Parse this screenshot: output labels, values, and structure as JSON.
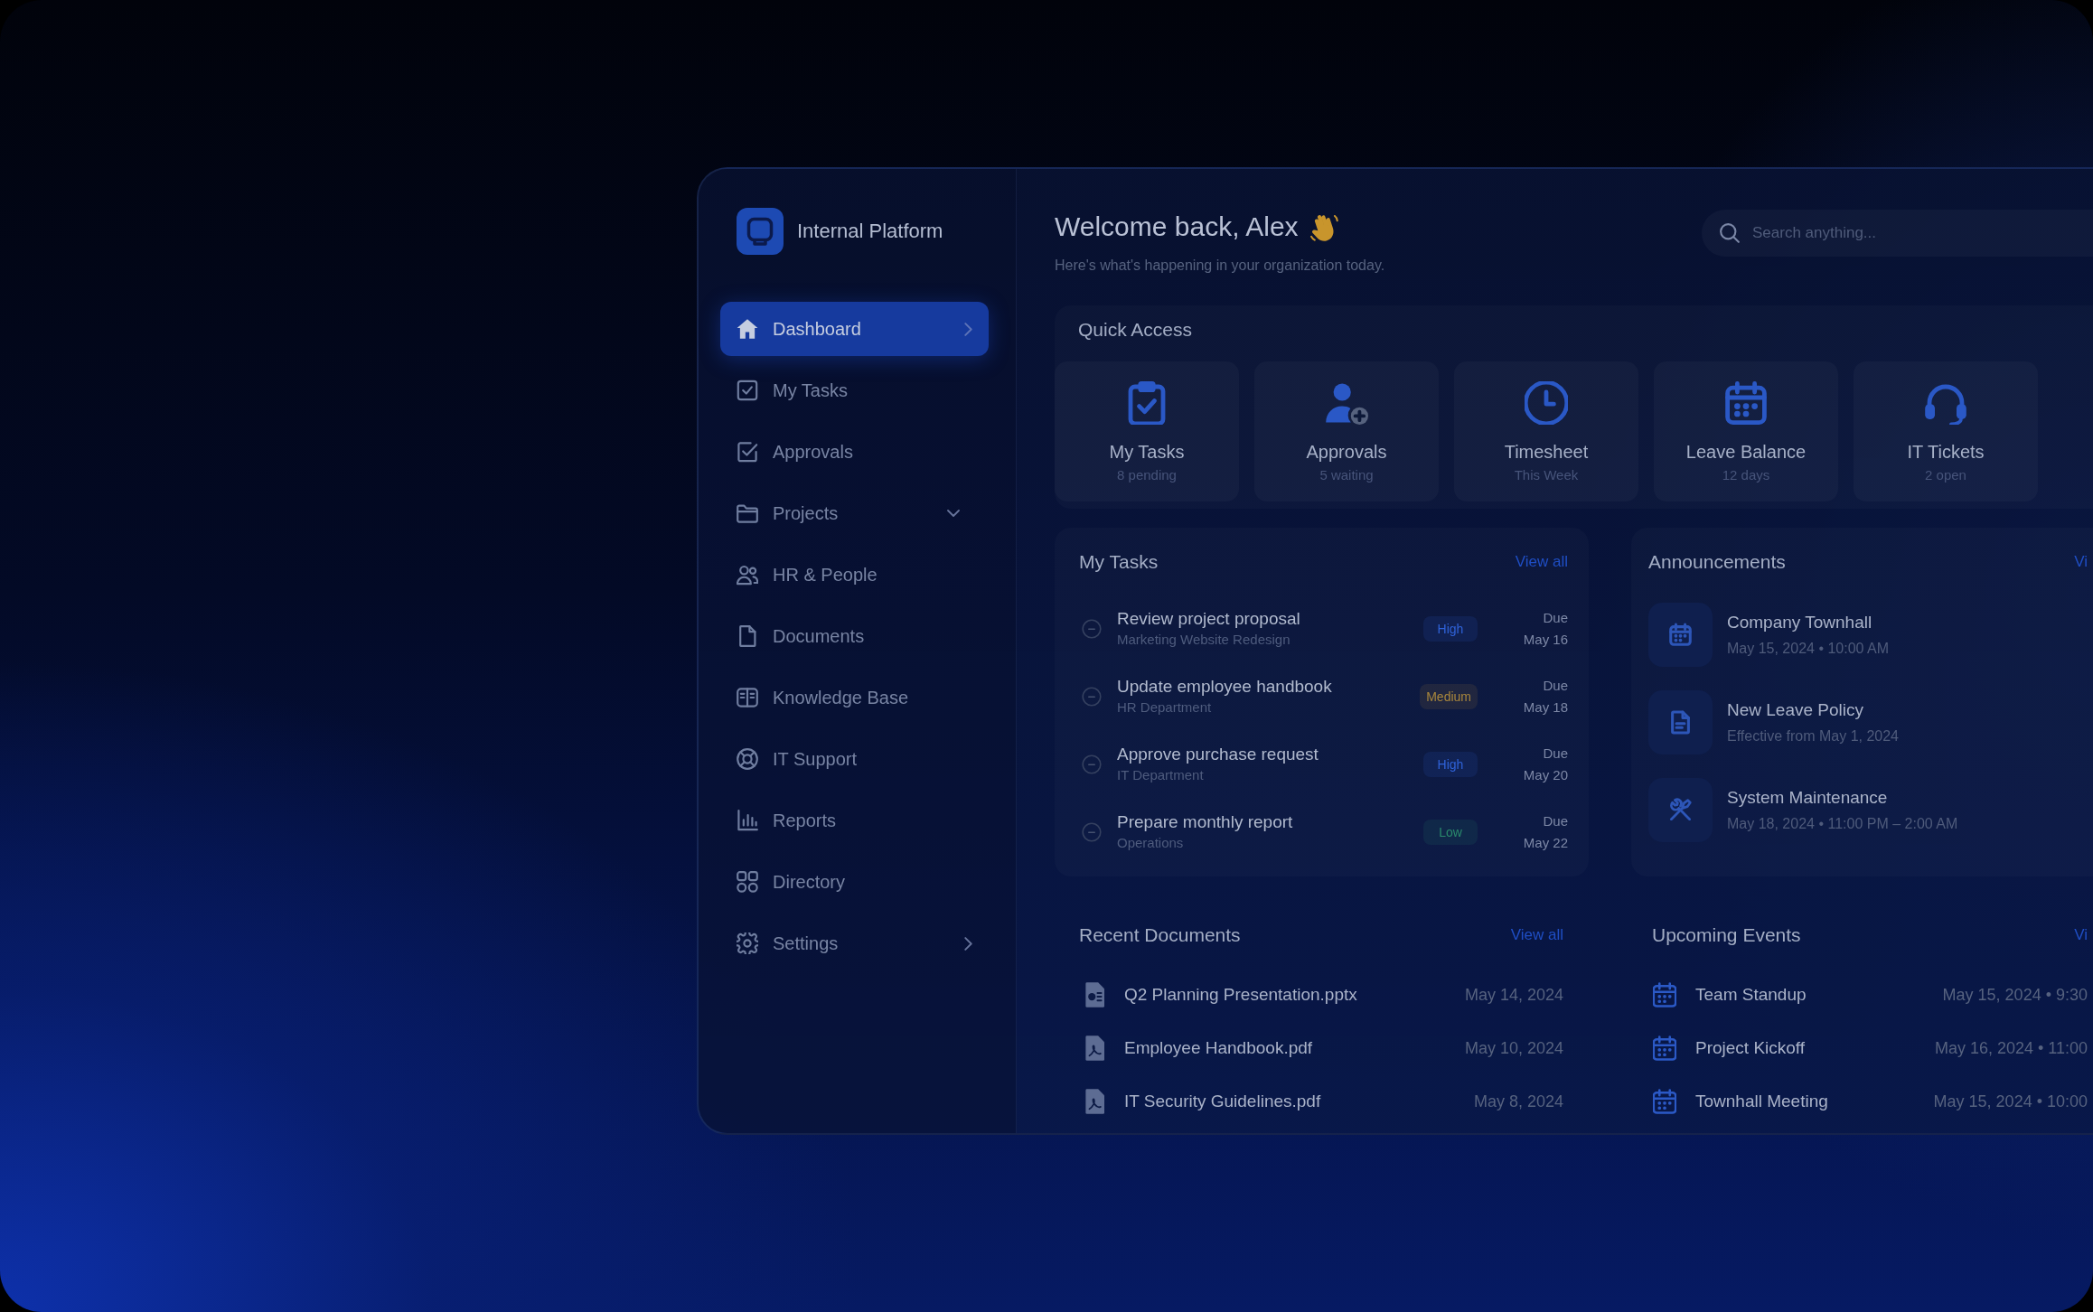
{
  "sidebar": {
    "brand": "Internal Platform",
    "items": [
      {
        "label": "Dashboard",
        "selected": true,
        "kind": "submenu"
      },
      {
        "label": "My Tasks",
        "selected": false,
        "kind": "plain"
      },
      {
        "label": "Approvals",
        "selected": false,
        "kind": "plain"
      },
      {
        "label": "Projects",
        "selected": false,
        "kind": "dropdown"
      },
      {
        "label": "HR & People",
        "selected": false,
        "kind": "plain"
      },
      {
        "label": "Documents",
        "selected": false,
        "kind": "plain"
      },
      {
        "label": "Knowledge Base",
        "selected": false,
        "kind": "plain"
      },
      {
        "label": "IT Support",
        "selected": false,
        "kind": "plain"
      },
      {
        "label": "Reports",
        "selected": false,
        "kind": "plain"
      },
      {
        "label": "Directory",
        "selected": false,
        "kind": "plain"
      },
      {
        "label": "Settings",
        "selected": false,
        "kind": "submenu"
      }
    ]
  },
  "header": {
    "title": "Welcome back, Alex",
    "subtitle": "Here's what's happening in your organization today.",
    "search": {
      "placeholder": "Search anything..."
    }
  },
  "quick_access": {
    "title": "Quick Access",
    "tiles": [
      {
        "label": "My Tasks",
        "detail": "8 pending"
      },
      {
        "label": "Approvals",
        "detail": "5 waiting"
      },
      {
        "label": "Timesheet",
        "detail": "This Week"
      },
      {
        "label": "Leave Balance",
        "detail": "12 days"
      },
      {
        "label": "IT Tickets",
        "detail": "2 open"
      }
    ]
  },
  "my_tasks": {
    "title": "My Tasks",
    "link": "View all",
    "items": [
      {
        "checked": false,
        "title": "Review project proposal",
        "project": "Marketing Website Redesign",
        "priority": "High",
        "color": "#2f62d8",
        "due_label": "Due",
        "due_date": "May 16"
      },
      {
        "checked": false,
        "title": "Update employee handbook",
        "project": "HR Department",
        "priority": "Medium",
        "color": "#a8863c",
        "due_label": "Due",
        "due_date": "May 18"
      },
      {
        "checked": false,
        "title": "Approve purchase request",
        "project": "IT Department",
        "priority": "High",
        "color": "#2f62d8",
        "due_label": "Due",
        "due_date": "May 20"
      },
      {
        "checked": false,
        "title": "Prepare monthly report",
        "project": "Operations",
        "priority": "Low",
        "color": "#2a8a6c",
        "due_label": "Due",
        "due_date": "May 22"
      }
    ]
  },
  "announcements": {
    "title": "Announcements",
    "link": "Vi",
    "items": [
      {
        "title": "Company Townhall",
        "detail": "May 15, 2024 • 10:00 AM"
      },
      {
        "title": "New Leave Policy",
        "detail": "Effective from May 1, 2024"
      },
      {
        "title": "System Maintenance",
        "detail": "May 18, 2024 • 11:00 PM – 2:00 AM"
      }
    ]
  },
  "recent_documents": {
    "title": "Recent Documents",
    "link": "View all",
    "items": [
      {
        "name": "Q2 Planning Presentation.pptx",
        "kind": "presentation",
        "date": "May 14, 2024"
      },
      {
        "name": "Employee Handbook.pdf",
        "kind": "pdf",
        "date": "May 10, 2024"
      },
      {
        "name": "IT Security Guidelines.pdf",
        "kind": "pdf",
        "date": "May 8, 2024"
      }
    ]
  },
  "upcoming_events": {
    "title": "Upcoming Events",
    "link": "Vi",
    "items": [
      {
        "name": "Team Standup",
        "time": "May 15, 2024 • 9:30"
      },
      {
        "name": "Project Kickoff",
        "time": "May 16, 2024 • 11:00"
      },
      {
        "name": "Townhall Meeting",
        "time": "May 15, 2024 • 10:00"
      }
    ]
  }
}
